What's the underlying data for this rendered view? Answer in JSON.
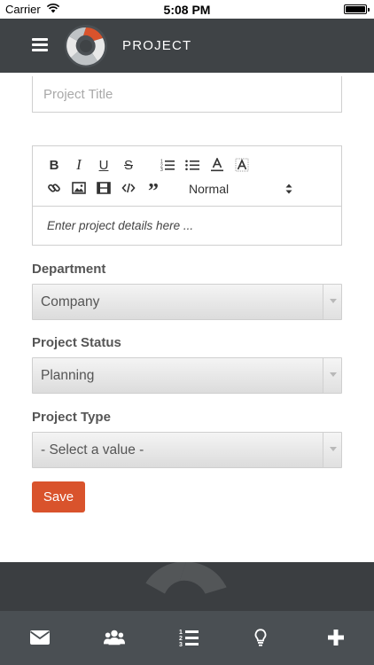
{
  "status_bar": {
    "carrier": "Carrier",
    "time": "5:08 PM"
  },
  "navbar": {
    "title": "PROJECT",
    "menu_icon": "hamburger-menu-icon",
    "logo_icon": "swirl-logo-icon"
  },
  "form": {
    "title_placeholder": "Project Title",
    "editor": {
      "toolbar": {
        "bold": "B",
        "italic": "I",
        "underline": "U",
        "strike": "S",
        "quote": "”",
        "format_value": "Normal",
        "icons": [
          "bold-icon",
          "italic-icon",
          "underline-icon",
          "strikethrough-icon",
          "ordered-list-icon",
          "bullet-list-icon",
          "font-color-icon",
          "background-color-icon",
          "link-icon",
          "image-icon",
          "video-icon",
          "code-icon",
          "blockquote-icon"
        ]
      },
      "placeholder": "Enter project details here ..."
    },
    "department": {
      "label": "Department",
      "value": "Company"
    },
    "status": {
      "label": "Project Status",
      "value": "Planning"
    },
    "type": {
      "label": "Project Type",
      "value": "- Select a value -"
    },
    "save_label": "Save"
  },
  "tabbar": {
    "items": [
      "mail-icon",
      "users-icon",
      "numbered-list-icon",
      "lightbulb-icon",
      "plus-icon"
    ]
  },
  "colors": {
    "navbar": "#3f4346",
    "accent": "#d9532c",
    "tabbar": "#4a4f53"
  }
}
